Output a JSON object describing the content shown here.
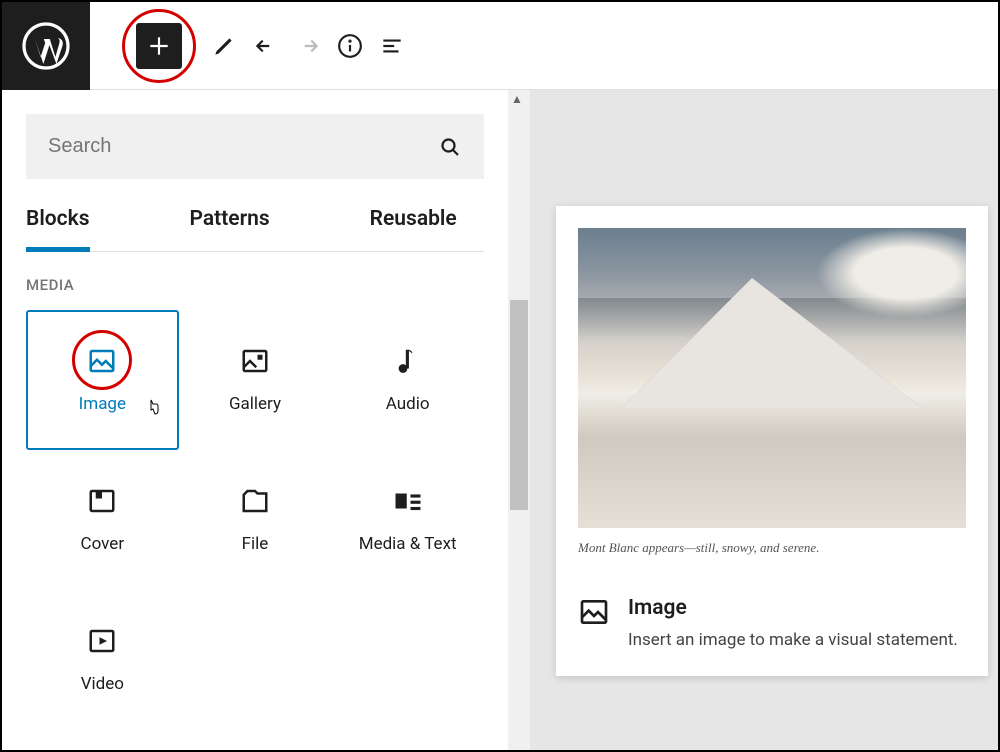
{
  "search": {
    "placeholder": "Search"
  },
  "tabs": {
    "blocks": "Blocks",
    "patterns": "Patterns",
    "reusable": "Reusable"
  },
  "category": "MEDIA",
  "blocks": {
    "image": "Image",
    "gallery": "Gallery",
    "audio": "Audio",
    "cover": "Cover",
    "file": "File",
    "media_text": "Media & Text",
    "video": "Video"
  },
  "preview": {
    "caption": "Mont Blanc appears—still, snowy, and serene.",
    "title": "Image",
    "description": "Insert an image to make a visual statement."
  }
}
